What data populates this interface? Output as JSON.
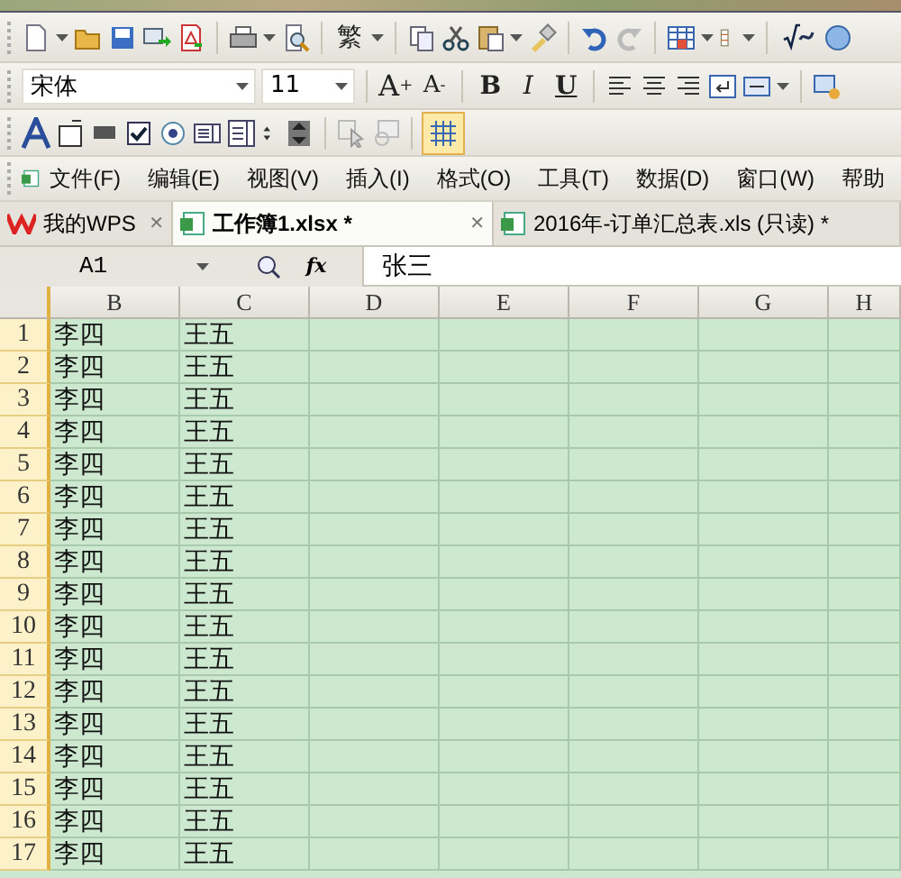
{
  "toolbar_standard": {
    "traditional_chinese": "繁"
  },
  "toolbar_format": {
    "font": "宋体",
    "font_size": "11",
    "grow_font": "A",
    "grow_mark": "+",
    "shrink_font": "A",
    "shrink_mark": "-",
    "bold": "B",
    "italic": "I",
    "underline": "U"
  },
  "toolbar_forms": {
    "grid_toggle": {
      "on": true
    }
  },
  "menu": [
    "文件(F)",
    "编辑(E)",
    "视图(V)",
    "插入(I)",
    "格式(O)",
    "工具(T)",
    "数据(D)",
    "窗口(W)",
    "帮助"
  ],
  "tabs": [
    {
      "label": "我的WPS",
      "kind": "home",
      "selected": false,
      "close": "✕"
    },
    {
      "label": "工作簿1.xlsx *",
      "kind": "sheet",
      "selected": true,
      "close": "✕"
    },
    {
      "label": "2016年-订单汇总表.xls (只读) *",
      "kind": "sheet",
      "selected": false
    }
  ],
  "formula_bar": {
    "cell_ref": "A1",
    "fx": "fx",
    "value": "张三"
  },
  "sheet": {
    "columns": [
      "B",
      "C",
      "D",
      "E",
      "F",
      "G",
      "H"
    ],
    "rows": [
      {
        "number": "1",
        "cells": [
          "李四",
          "王五"
        ]
      },
      {
        "number": "2",
        "cells": [
          "李四",
          "王五"
        ]
      },
      {
        "number": "3",
        "cells": [
          "李四",
          "王五"
        ]
      },
      {
        "number": "4",
        "cells": [
          "李四",
          "王五"
        ]
      },
      {
        "number": "5",
        "cells": [
          "李四",
          "王五"
        ]
      },
      {
        "number": "6",
        "cells": [
          "李四",
          "王五"
        ]
      },
      {
        "number": "7",
        "cells": [
          "李四",
          "王五"
        ]
      },
      {
        "number": "8",
        "cells": [
          "李四",
          "王五"
        ]
      },
      {
        "number": "9",
        "cells": [
          "李四",
          "王五"
        ]
      },
      {
        "number": "10",
        "cells": [
          "李四",
          "王五"
        ]
      },
      {
        "number": "11",
        "cells": [
          "李四",
          "王五"
        ]
      },
      {
        "number": "12",
        "cells": [
          "李四",
          "王五"
        ]
      },
      {
        "number": "13",
        "cells": [
          "李四",
          "王五"
        ]
      },
      {
        "number": "14",
        "cells": [
          "李四",
          "王五"
        ]
      },
      {
        "number": "15",
        "cells": [
          "李四",
          "王五"
        ]
      },
      {
        "number": "16",
        "cells": [
          "李四",
          "王五"
        ]
      },
      {
        "number": "17",
        "cells": [
          "李四",
          "王五"
        ]
      }
    ]
  }
}
